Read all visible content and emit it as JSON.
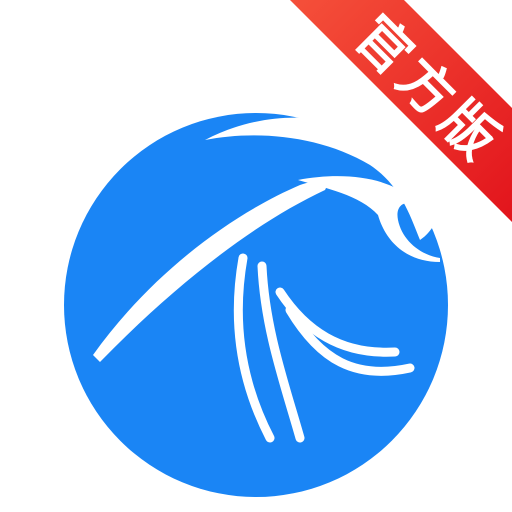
{
  "icon": {
    "name": "brand-logo-icon",
    "circle_color": "#1A85F5",
    "swirl_color": "#FFFFFF",
    "background_color": "#FFFFFF"
  },
  "badge": {
    "label": "官方版",
    "gradient_start": "#F5503A",
    "gradient_end": "#E2141C",
    "text_color": "#FFFFFF"
  }
}
